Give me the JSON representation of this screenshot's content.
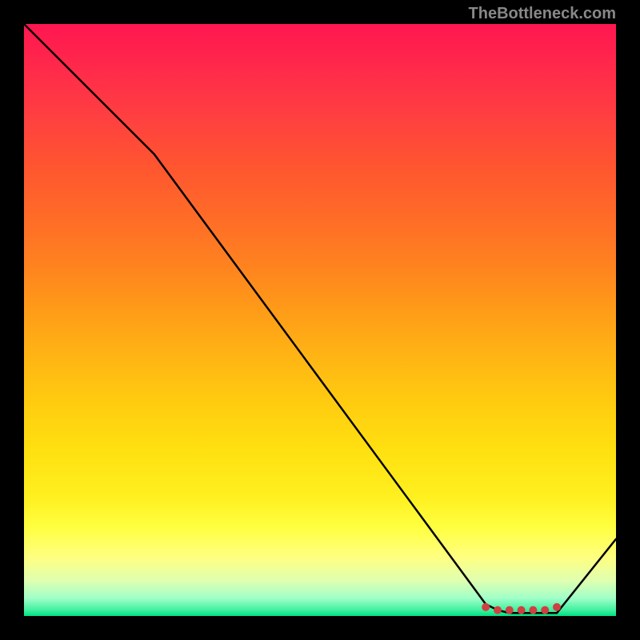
{
  "attribution": "TheBottleneck.com",
  "chart_data": {
    "type": "line",
    "title": "",
    "xlabel": "",
    "ylabel": "",
    "xlim": [
      0,
      100
    ],
    "ylim": [
      0,
      100
    ],
    "x": [
      0,
      22,
      78,
      80,
      82,
      84,
      86,
      88,
      90,
      100
    ],
    "values": [
      100,
      78,
      2,
      1,
      0.5,
      0.5,
      0.5,
      0.5,
      0.5,
      13
    ],
    "markers": {
      "x": [
        78,
        80,
        82,
        84,
        86,
        88,
        90
      ],
      "values": [
        1.5,
        1,
        1,
        1,
        1,
        1,
        1.5
      ],
      "color": "#d04040"
    },
    "line_color": "#000000",
    "background": "rainbow-vertical-gradient"
  }
}
